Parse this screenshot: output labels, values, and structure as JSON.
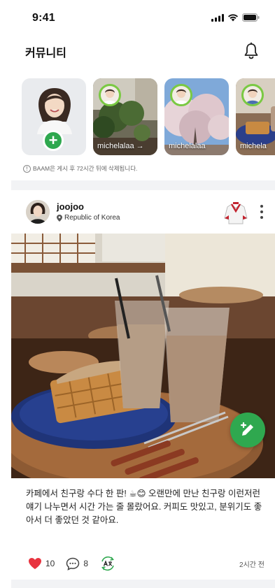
{
  "status_bar": {
    "time": "9:41"
  },
  "header": {
    "title": "커뮤니티",
    "icon": "bell-icon"
  },
  "stories": {
    "items": [
      {
        "type": "mine",
        "action_icon": "plus-icon"
      },
      {
        "name": "michelalaa →"
      },
      {
        "name": "michelalaa"
      },
      {
        "name": "michela"
      }
    ],
    "notice": "BAAM은 게시 후 72시간 뒤에 삭제됩니다."
  },
  "post": {
    "author": "joojoo",
    "location": "Republic of Korea",
    "text": "카페에서 친구랑 수다 한 판! ☕😊 오랜만에 만난 친구랑 이런저런 얘기 나누면서 시간 가는 줄 몰랐어요. 커피도 맛있고, 분위기도 좋아서 더 좋았던 것 같아요.",
    "likes": "10",
    "comments": "8",
    "time_ago": "2시간 전"
  },
  "colors": {
    "accent": "#2fa84f",
    "like": "#e8333f",
    "divider": "#f2f3f5"
  }
}
